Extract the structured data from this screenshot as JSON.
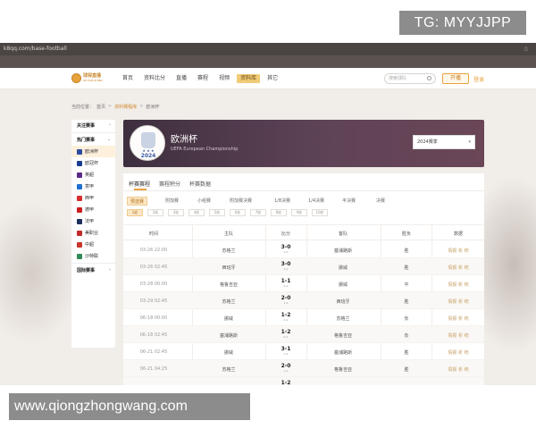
{
  "tg_badge": "TG: MYYJJPP",
  "url": "k8qq.com/base-football",
  "logo": {
    "title": "球探直播",
    "subtitle": "QIUTAN ZHIBO"
  },
  "nav": [
    "首页",
    "资料比分",
    "直播",
    "赛程",
    "视频",
    "资料库",
    "其它"
  ],
  "search_placeholder": "搜索球队",
  "open_button": "开播",
  "login": "登录",
  "breadcrumb": {
    "label": "当前位置：",
    "items": [
      "首页",
      "资料赛程库",
      "欧洲杯"
    ]
  },
  "sidebar": {
    "followed": "关注赛事",
    "hot": "热门赛事",
    "leagues": [
      {
        "label": "欧洲杯",
        "color": "#2c4aa0"
      },
      {
        "label": "欧冠杯",
        "color": "#1a3c8f"
      },
      {
        "label": "英超",
        "color": "#5b2a86"
      },
      {
        "label": "意甲",
        "color": "#1f6fd0"
      },
      {
        "label": "西甲",
        "color": "#d62d2d"
      },
      {
        "label": "德甲",
        "color": "#c81e1e"
      },
      {
        "label": "法甲",
        "color": "#1d2f5c"
      },
      {
        "label": "美职业",
        "color": "#c22b2b"
      },
      {
        "label": "中超",
        "color": "#c9342b"
      },
      {
        "label": "沙特联",
        "color": "#2e8b57"
      }
    ],
    "international": "国际赛事"
  },
  "hero": {
    "title": "欧洲杯",
    "subtitle": "UEFA European Championship",
    "emblem_year": "2024",
    "season": "2024赛季"
  },
  "tabs": [
    "杯赛赛程",
    "赛程积分",
    "杯赛数据"
  ],
  "rounds": [
    "预选赛",
    "附加赛",
    "小组赛",
    "附加赛决赛",
    "1/8决赛",
    "1/4决赛",
    "半决赛",
    "决赛"
  ],
  "matchdays": [
    "1轮",
    "2轮",
    "3轮",
    "4轮",
    "5轮",
    "6轮",
    "7轮",
    "8轮",
    "9轮",
    "10轮"
  ],
  "table": {
    "headers": [
      "时间",
      "主队",
      "比分",
      "客队",
      "胜负",
      "数据"
    ],
    "rows": [
      {
        "time": "03-26 22:00",
        "home": "苏格兰",
        "score": "3-0",
        "half": "1-0",
        "away": "塞浦路斯",
        "result": "胜",
        "data": "情报 析 统"
      },
      {
        "time": "03-26 02:45",
        "home": "西班牙",
        "score": "3-0",
        "half": "1-0",
        "away": "挪威",
        "result": "胜",
        "data": "情报 析 统"
      },
      {
        "time": "03-28 00:00",
        "home": "格鲁吉亚",
        "score": "1-1",
        "half": "0-1",
        "away": "挪威",
        "result": "平",
        "data": "情报 析 统"
      },
      {
        "time": "03-29 02:45",
        "home": "苏格兰",
        "score": "2-0",
        "half": "1-0",
        "away": "西班牙",
        "result": "胜",
        "data": "情报 析 统"
      },
      {
        "time": "06-18 00:00",
        "home": "挪威",
        "score": "1-2",
        "half": "0-1",
        "away": "苏格兰",
        "result": "负",
        "data": "情报 析 统"
      },
      {
        "time": "06-18 02:45",
        "home": "塞浦路斯",
        "score": "1-2",
        "half": "0-1",
        "away": "格鲁吉亚",
        "result": "负",
        "data": "情报 析 统"
      },
      {
        "time": "06-21 02:45",
        "home": "挪威",
        "score": "3-1",
        "half": "1-0",
        "away": "塞浦路斯",
        "result": "胜",
        "data": "情报 析 统"
      },
      {
        "time": "06-21 04:25",
        "home": "苏格兰",
        "score": "2-0",
        "half": "1-0",
        "away": "格鲁吉亚",
        "result": "胜",
        "data": "情报 析 统"
      }
    ],
    "partial_score": "1-2"
  },
  "watermark": "www.qiongzhongwang.com"
}
